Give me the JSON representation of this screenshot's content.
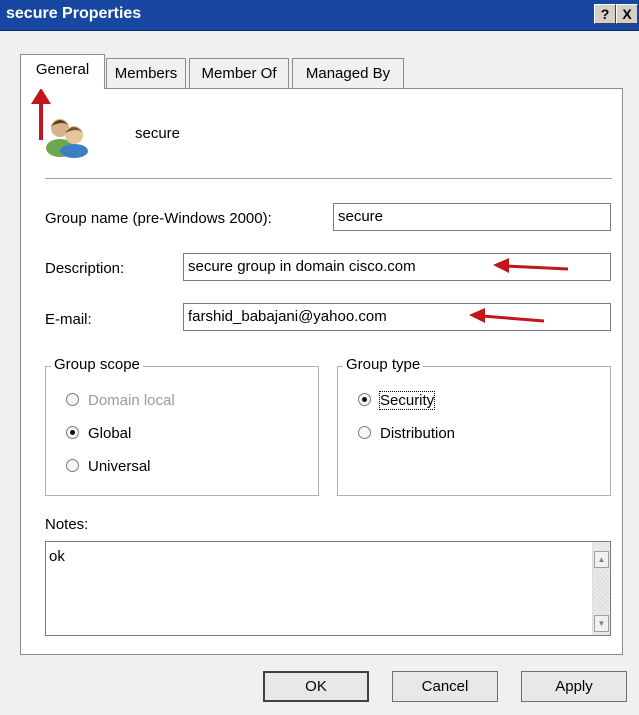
{
  "window": {
    "title": "secure Properties",
    "help_btn": "?",
    "close_btn": "X"
  },
  "tabs": [
    {
      "label": "General",
      "active": true
    },
    {
      "label": "Members"
    },
    {
      "label": "Member Of"
    },
    {
      "label": "Managed By"
    }
  ],
  "general": {
    "icon": "group-users-icon",
    "group_display_name": "secure",
    "group_name_label": "Group name (pre-Windows 2000):",
    "group_name_value": "secure",
    "description_label": "Description:",
    "description_value": "secure group in domain cisco.com",
    "email_label": "E-mail:",
    "email_value": "farshid_babajani@yahoo.com",
    "group_scope": {
      "title": "Group scope",
      "options": [
        {
          "label": "Domain local",
          "checked": false,
          "disabled": true
        },
        {
          "label": "Global",
          "checked": true
        },
        {
          "label": "Universal",
          "checked": false
        }
      ]
    },
    "group_type": {
      "title": "Group type",
      "options": [
        {
          "label": "Security",
          "checked": true
        },
        {
          "label": "Distribution",
          "checked": false
        }
      ]
    },
    "notes_label": "Notes:",
    "notes_value": "ok"
  },
  "buttons": {
    "ok": "OK",
    "cancel": "Cancel",
    "apply": "Apply"
  },
  "colors": {
    "titlebar": "#1747a0",
    "annotation_arrow": "#c0161c"
  }
}
